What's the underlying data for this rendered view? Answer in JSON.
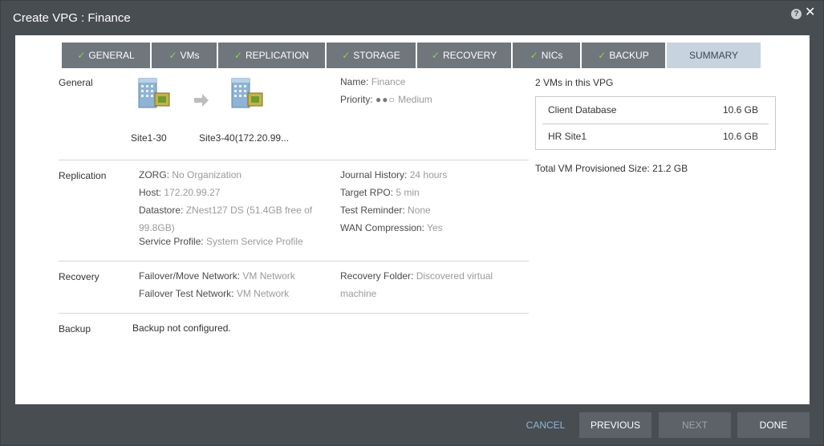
{
  "window": {
    "title": "Create VPG : Finance"
  },
  "tabs": [
    {
      "label": "GENERAL",
      "done": true
    },
    {
      "label": "VMs",
      "done": true
    },
    {
      "label": "REPLICATION",
      "done": true
    },
    {
      "label": "STORAGE",
      "done": true
    },
    {
      "label": "RECOVERY",
      "done": true
    },
    {
      "label": "NICs",
      "done": true
    },
    {
      "label": "BACKUP",
      "done": true
    },
    {
      "label": "SUMMARY",
      "done": false
    }
  ],
  "general": {
    "section": "General",
    "source_site": "Site1-30",
    "target_site": "Site3-40(172.20.99...",
    "name_label": "Name:",
    "name_value": "Finance",
    "priority_label": "Priority:",
    "priority_dots": "●●○",
    "priority_value": "Medium"
  },
  "replication": {
    "section": "Replication",
    "zorg_label": "ZORG:",
    "zorg_value": "No Organization",
    "host_label": "Host:",
    "host_value": "172.20.99.27",
    "datastore_label": "Datastore:",
    "datastore_value_1": "ZNest127 DS (51.4GB free of",
    "datastore_value_2": "99.8GB)",
    "service_label": "Service Profile:",
    "service_value": "System Service Profile",
    "journal_label": "Journal History:",
    "journal_value": "24 hours",
    "rpo_label": "Target RPO:",
    "rpo_value": "5 min",
    "reminder_label": "Test Reminder:",
    "reminder_value": "None",
    "wan_label": "WAN Compression:",
    "wan_value": "Yes"
  },
  "recovery": {
    "section": "Recovery",
    "failover_label": "Failover/Move Network:",
    "failover_value": "VM Network",
    "test_label": "Failover Test Network:",
    "test_value": "VM Network",
    "folder_label": "Recovery Folder:",
    "folder_value_1": "Discovered virtual",
    "folder_value_2": "machine"
  },
  "backup": {
    "section": "Backup",
    "value": "Backup not configured."
  },
  "vms": {
    "header": "2 VMs in this VPG",
    "items": [
      {
        "name": "Client Database",
        "size": "10.6 GB"
      },
      {
        "name": "HR Site1",
        "size": "10.6 GB"
      }
    ],
    "total": "Total VM Provisioned Size: 21.2 GB"
  },
  "footer": {
    "cancel": "CANCEL",
    "previous": "PREVIOUS",
    "next": "NEXT",
    "done": "DONE"
  },
  "colors": {
    "check": "#8fd14f",
    "tab_active": "#c7d4df",
    "tab_inactive": "#6f767c",
    "link": "#8fb7d6"
  },
  "icons": {
    "site": "building-icon",
    "arrow": "arrow-right-icon",
    "help": "help-icon",
    "close": "close-icon"
  }
}
